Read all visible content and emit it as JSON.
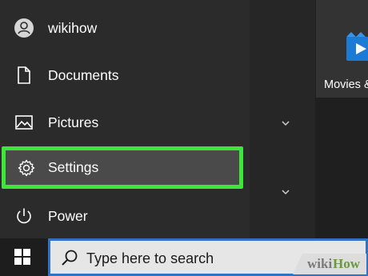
{
  "start_menu": {
    "items": [
      {
        "label": "wikihow",
        "icon": "user-avatar-icon"
      },
      {
        "label": "Documents",
        "icon": "document-icon"
      },
      {
        "label": "Pictures",
        "icon": "pictures-icon"
      },
      {
        "label": "Settings",
        "icon": "gear-icon"
      },
      {
        "label": "Power",
        "icon": "power-icon"
      }
    ],
    "tile": {
      "label": "Movies & TV",
      "icon": "movies-tv-icon"
    }
  },
  "taskbar": {
    "search_placeholder": "Type here to search",
    "start_icon": "windows-logo-icon"
  },
  "watermark": {
    "part1": "wiki",
    "part2": "How"
  },
  "colors": {
    "highlight": "#3ee63a",
    "menu_bg": "#2b2b2b",
    "search_border": "#2f72c8",
    "tile_blue": "#1c7bd4"
  }
}
